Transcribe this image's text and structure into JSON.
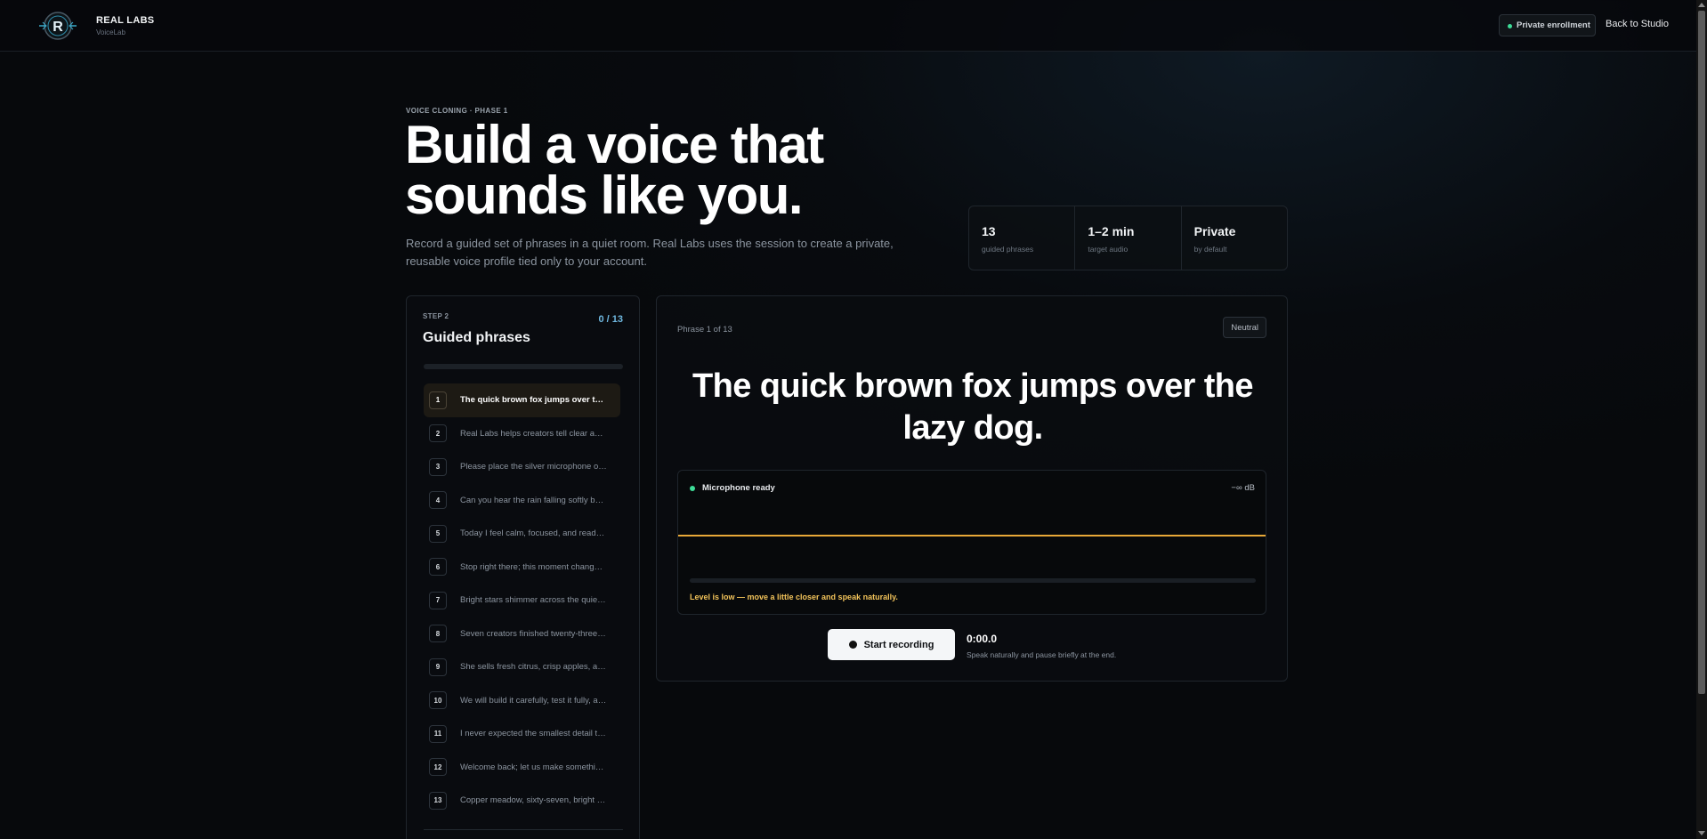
{
  "header": {
    "brand_name": "REAL LABS",
    "brand_sub": "VoiceLab",
    "enrollment_badge": "Private enrollment",
    "back_link": "Back to Studio"
  },
  "hero": {
    "eyebrow": "VOICE CLONING · PHASE 1",
    "title": "Build a voice that sounds like you.",
    "description": "Record a guided set of phrases in a quiet room. Real Labs uses the session to create a private, reusable voice profile tied only to your account."
  },
  "stats": [
    {
      "value": "13",
      "label": "guided phrases"
    },
    {
      "value": "1–2 min",
      "label": "target audio"
    },
    {
      "value": "Private",
      "label": "by default"
    }
  ],
  "guided": {
    "step_label": "STEP 2",
    "title": "Guided phrases",
    "count": "0 / 13",
    "progress_fraction": 0,
    "active_index": 0,
    "phrases": [
      {
        "num": "1",
        "text": "The quick brown fox jumps over the lazy dog."
      },
      {
        "num": "2",
        "text": "Real Labs helps creators tell clear and engaging stories."
      },
      {
        "num": "3",
        "text": "Please place the silver microphone on the table."
      },
      {
        "num": "4",
        "text": "Can you hear the rain falling softly beyond the window?"
      },
      {
        "num": "5",
        "text": "Today I feel calm, focused, and ready to begin."
      },
      {
        "num": "6",
        "text": "Stop right there; this moment changes everything."
      },
      {
        "num": "7",
        "text": "Bright stars shimmer across the quiet evening sky."
      },
      {
        "num": "8",
        "text": "Seven creators finished twenty-three projects this week."
      },
      {
        "num": "9",
        "text": "She sells fresh citrus, crisp apples, and sweet berries."
      },
      {
        "num": "10",
        "text": "We will build it carefully, test it fully, and ship it."
      },
      {
        "num": "11",
        "text": "I never expected the smallest detail to matter so much."
      },
      {
        "num": "12",
        "text": "Welcome back; let us make something wonderful today."
      },
      {
        "num": "13",
        "text": "Copper meadow, sixty-seven, bright horizon, gentle tide."
      }
    ]
  },
  "recorder": {
    "phrase_counter": "Phrase 1 of 13",
    "tone": "Neutral",
    "current_phrase": "The quick brown fox jumps over the lazy dog.",
    "mic_status": "Microphone ready",
    "db_readout": "−∞ dB",
    "level_fraction": 0,
    "level_warning": "Level is low — move a little closer and speak naturally.",
    "record_button": "Start recording",
    "timer": "0:00.0",
    "timer_hint": "Speak naturally and pause briefly at the end."
  },
  "colors": {
    "accent_green": "#3ddc97",
    "accent_amber": "#e8a838",
    "accent_blue": "#6fb8e0",
    "warning_text": "#f2c35a"
  },
  "icons": {
    "logo": "real-labs-logo",
    "status_dot": "status-dot-icon",
    "record": "record-dot-icon"
  }
}
